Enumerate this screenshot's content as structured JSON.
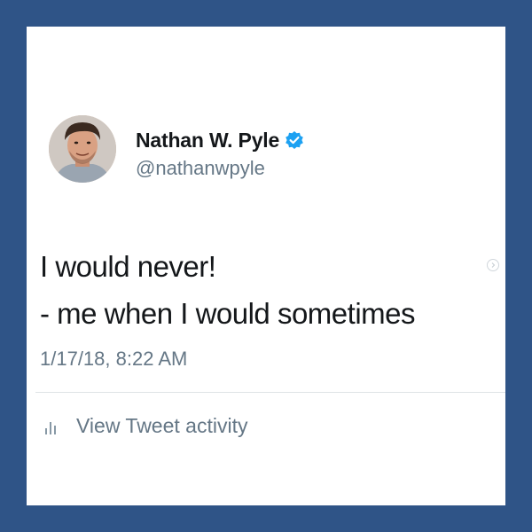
{
  "tweet": {
    "display_name": "Nathan W. Pyle",
    "handle": "@nathanwpyle",
    "verified": true,
    "text_lines": [
      "I would never!",
      "- me when I would sometimes"
    ],
    "timestamp": "1/17/18, 8:22 AM",
    "activity_label": "View Tweet activity"
  },
  "icons": {
    "verified": "verified-badge-icon",
    "activity": "bar-chart-icon",
    "next": "chevron-right-icon"
  },
  "colors": {
    "frame_background": "#2f5487",
    "card_background": "#ffffff",
    "verified_badge": "#1da1f2",
    "primary_text": "#14171a",
    "secondary_text": "#657786"
  }
}
